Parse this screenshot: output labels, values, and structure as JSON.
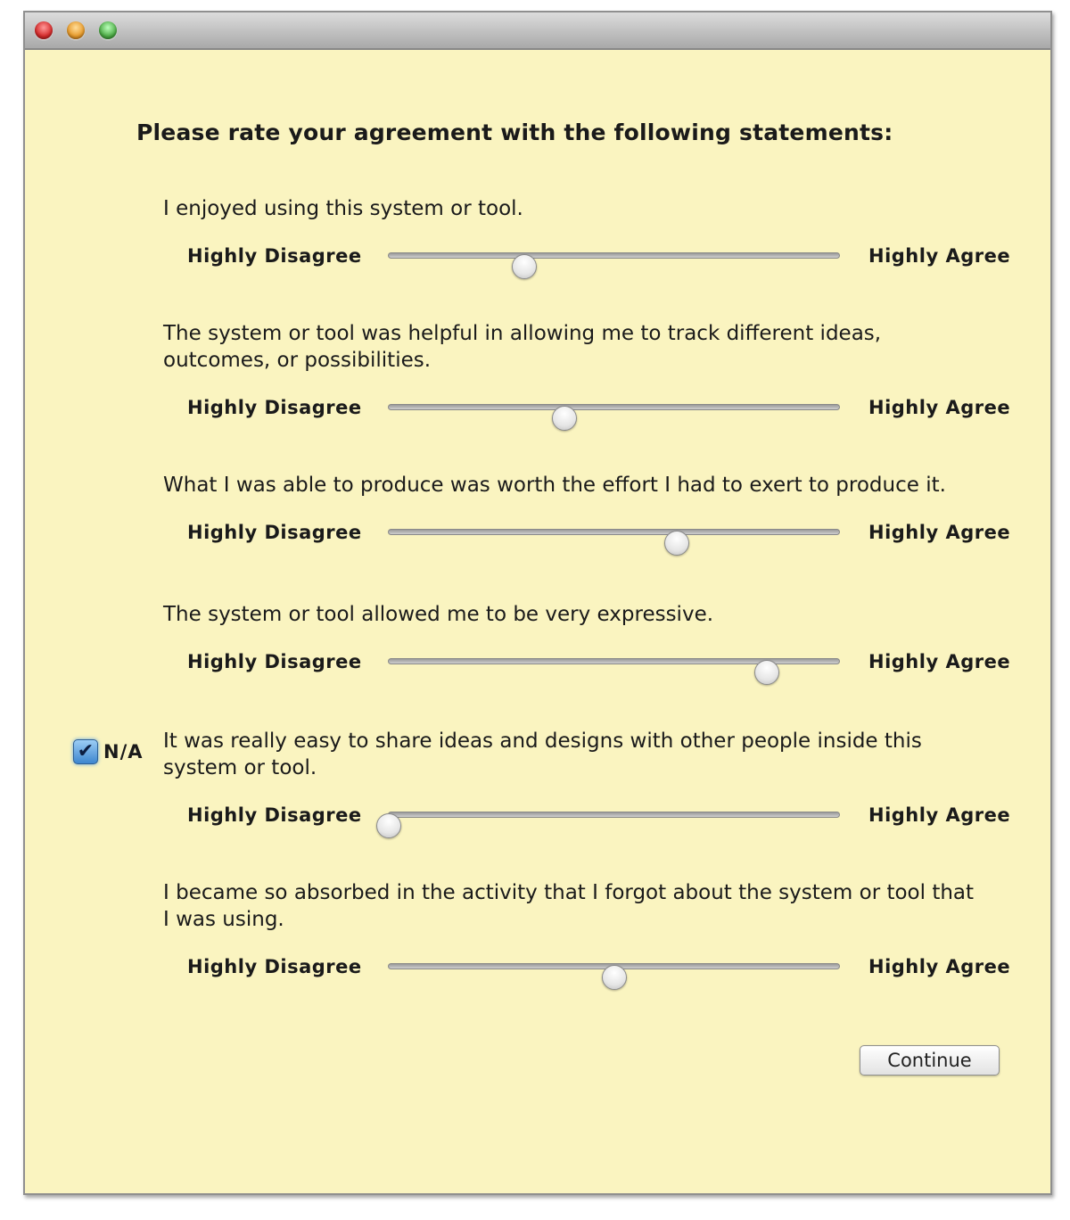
{
  "window": {
    "traffic_lights": [
      "close",
      "minimize",
      "zoom"
    ]
  },
  "heading": "Please rate your agreement with the following statements:",
  "scale": {
    "low_label": "Highly Disagree",
    "high_label": "Highly Agree"
  },
  "questions": [
    {
      "text": "I enjoyed using this system or tool.",
      "value": 0.3
    },
    {
      "text": "The system or tool was helpful in allowing me to track different ideas, outcomes, or possibilities.",
      "value": 0.39
    },
    {
      "text": "What I was able to produce was worth the effort I had to exert to produce it.",
      "value": 0.64
    },
    {
      "text": "The system or tool allowed me to be very expressive.",
      "value": 0.84
    },
    {
      "text": "It was really easy to share ideas and designs with other people inside this system or tool.",
      "value": 0.0
    },
    {
      "text": "I became so absorbed in the activity that I forgot about the system or tool that I was using.",
      "value": 0.5
    }
  ],
  "na_checkbox": {
    "label": "N/A",
    "checked": true,
    "check_glyph": "✔"
  },
  "continue_label": "Continue"
}
